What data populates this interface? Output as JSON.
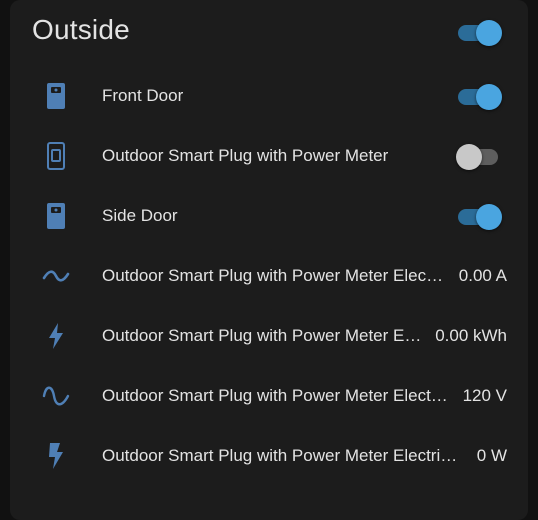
{
  "card": {
    "title": "Outside",
    "toggle_on": true
  },
  "colors": {
    "accent": "#4aa5e0",
    "icon": "#4f7fb5",
    "text": "#e3e3e3",
    "card_bg": "#1c1c1c"
  },
  "entities": [
    {
      "icon": "door-sensor-icon",
      "label": "Front Door",
      "type": "toggle",
      "on": true
    },
    {
      "icon": "smart-plug-icon",
      "label": "Outdoor Smart Plug with Power Meter",
      "type": "toggle",
      "on": false
    },
    {
      "icon": "door-sensor-icon",
      "label": "Side Door",
      "type": "toggle",
      "on": true
    },
    {
      "icon": "current-ac-icon",
      "label": "Outdoor Smart Plug with Power Meter Elec…",
      "type": "value",
      "value": "0.00 A"
    },
    {
      "icon": "lightning-bolt-icon",
      "label": "Outdoor Smart Plug with Power Meter E…",
      "type": "value",
      "value": "0.00 kWh"
    },
    {
      "icon": "sine-wave-icon",
      "label": "Outdoor Smart Plug with Power Meter Elect…",
      "type": "value",
      "value": "120 V"
    },
    {
      "icon": "flash-icon",
      "label": "Outdoor Smart Plug with Power Meter Electri…",
      "type": "value",
      "value": "0 W"
    }
  ]
}
